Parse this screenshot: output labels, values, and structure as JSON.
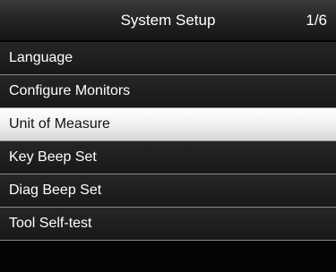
{
  "header": {
    "title": "System Setup",
    "page_indicator": "1/6"
  },
  "menu": {
    "selected_index": 2,
    "items": [
      {
        "label": "Language"
      },
      {
        "label": "Configure Monitors"
      },
      {
        "label": "Unit of Measure"
      },
      {
        "label": "Key Beep Set"
      },
      {
        "label": "Diag Beep Set"
      },
      {
        "label": "Tool Self-test"
      }
    ]
  },
  "colors": {
    "background": "#050505",
    "header_top": "#3a3a3a",
    "header_bottom": "#141414",
    "item_text": "#ffffff",
    "selected_bg": "#f0f0f0",
    "selected_text": "#111111",
    "divider": "#8a8a8a"
  }
}
